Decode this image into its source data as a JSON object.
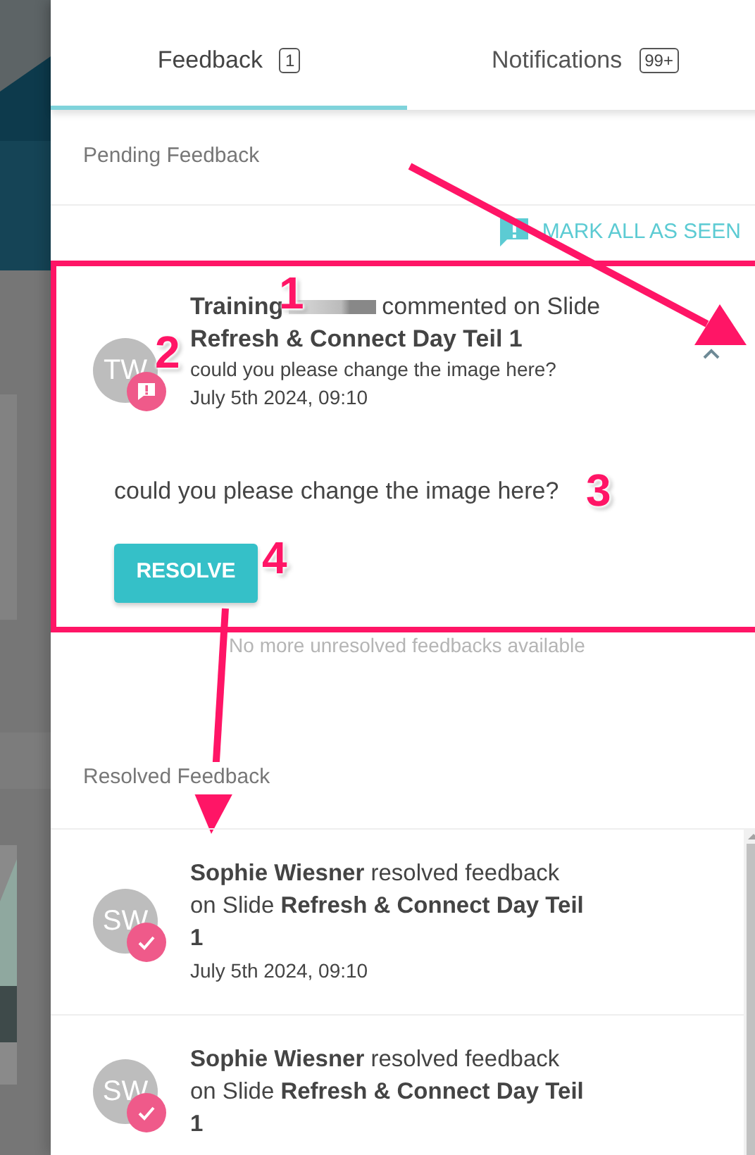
{
  "tabs": [
    {
      "label": "Feedback",
      "count": "1",
      "selected": true
    },
    {
      "label": "Notifications",
      "count": "99+",
      "selected": false
    }
  ],
  "pending": {
    "heading": "Pending Feedback",
    "mark_all_button": "MARK ALL AS SEEN",
    "items": [
      {
        "initials": "TW",
        "author": "Training",
        "redacted": true,
        "action": "commented on Slide",
        "slide": "Refresh & Connect Day Teil 1",
        "excerpt": "could you please change the image here?",
        "time": "July 5th 2024, 09:10",
        "expanded": true,
        "comment": "could you please change the image here?",
        "resolve_button": "RESOLVE",
        "highlighted": true
      }
    ],
    "empty_note": "No more unresolved feedbacks available"
  },
  "resolved": {
    "heading": "Resolved Feedback",
    "items": [
      {
        "initials": "SW",
        "text": "**Sophie Wiesner** resolved feedback on Slide **Refresh & Connect Day Teil 1**",
        "time": "July 5th 2024, 09:10"
      },
      {
        "initials": "SW",
        "text": "**Sophie Wiesner** resolved feedback on Slide **Refresh & Connect Day Teil 1**"
      }
    ]
  },
  "annotations": [
    {
      "label": "1"
    },
    {
      "label": "2"
    },
    {
      "label": "3"
    },
    {
      "label": "4"
    }
  ]
}
